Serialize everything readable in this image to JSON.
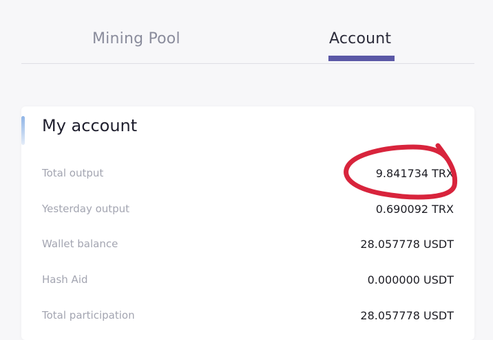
{
  "tabs": [
    {
      "label": "Mining Pool"
    },
    {
      "label": "Account"
    }
  ],
  "active_tab": "Account",
  "account": {
    "title": "My account",
    "rows": [
      {
        "label": "Total output",
        "value": "9.841734 TRX"
      },
      {
        "label": "Yesterday output",
        "value": "0.690092 TRX"
      },
      {
        "label": "Wallet balance",
        "value": "28.057778 USDT"
      },
      {
        "label": "Hash Aid",
        "value": "0.000000 USDT"
      },
      {
        "label": "Total participation",
        "value": "28.057778 USDT"
      }
    ]
  },
  "colors": {
    "accent": "#5b58a6",
    "annotation": "#d8243c"
  }
}
